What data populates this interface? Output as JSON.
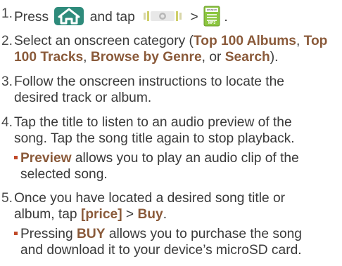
{
  "steps": [
    {
      "num": "1.",
      "t1": "Press",
      "t2": "and tap",
      "t3": ">",
      "t4": "."
    },
    {
      "num": "2.",
      "t1": "Select an onscreen category (",
      "c1": "Top 100 Albums",
      "sep1": ", ",
      "c2a": "Top",
      "c2b": "100 Tracks",
      "sep2": ", ",
      "c3": "Browse by Genre",
      "sep3": ", or ",
      "c4": "Search",
      "end": ")."
    },
    {
      "num": "3.",
      "line1": "Follow the onscreen instructions to locate the",
      "line2": "desired track or album."
    },
    {
      "num": "4.",
      "line1": "Tap the title to listen to an audio preview of the",
      "line2": "song. Tap the song title again to stop playback."
    },
    {
      "num": "5.",
      "line1": "Once you have located a desired song title or",
      "line2a": "album, tap ",
      "price": "[price]",
      "gt": " > ",
      "buy": "Buy",
      "dot": "."
    }
  ],
  "bullets": {
    "preview_bold": "Preview",
    "preview_l1": " allows you to play an audio clip of the",
    "preview_l2": "selected song.",
    "buy_pre": "Pressing ",
    "buy_bold": "BUY",
    "buy_l1": " allows you to purchase the song",
    "buy_l2": "and download it to your device’s microSD card."
  },
  "icons": {
    "home": "home-key-icon",
    "menu": "menu-handle-icon",
    "app": "amazon-mp3-app-icon",
    "app_label_top": "amazon",
    "app_label_bottom": "MP3"
  },
  "colors": {
    "text": "#3a3a3a",
    "bold_accent": "#8a5a3a",
    "bullet": "#c04a2a",
    "home_key": "#2e8b7b",
    "app_green": "#8cc63f"
  }
}
